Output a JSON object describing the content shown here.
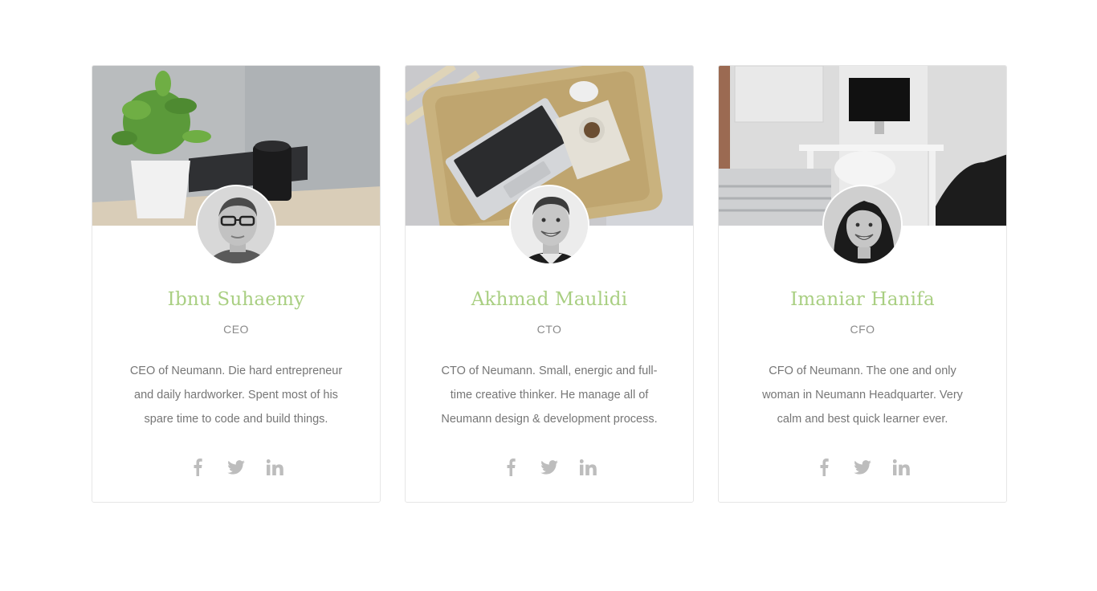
{
  "team": [
    {
      "name": "Ibnu Suhaemy",
      "role": "CEO",
      "bio": "CEO of Neumann. Die hard entrepreneur and daily hardworker. Spent most of his spare time to code and build things.",
      "cover": "plant-and-camera-desk",
      "social": [
        "facebook-icon",
        "twitter-icon",
        "linkedin-icon"
      ]
    },
    {
      "name": "Akhmad Maulidi",
      "role": "CTO",
      "bio": "CTO of Neumann. Small, energic and full-time creative thinker. He manage all of Neumann design & development process.",
      "cover": "laptop-on-tray",
      "social": [
        "facebook-icon",
        "twitter-icon",
        "linkedin-icon"
      ]
    },
    {
      "name": "Imaniar Hanifa",
      "role": "CFO",
      "bio": "CFO of Neumann. The one and only woman in Neumann Headquarter. Very calm and best quick learner ever.",
      "cover": "bright-home-office",
      "social": [
        "facebook-icon",
        "twitter-icon",
        "linkedin-icon"
      ]
    }
  ],
  "colors": {
    "accent": "#a9cf82",
    "text": "#767676",
    "icon": "#bdbdbd",
    "border": "#e6e6e6"
  }
}
